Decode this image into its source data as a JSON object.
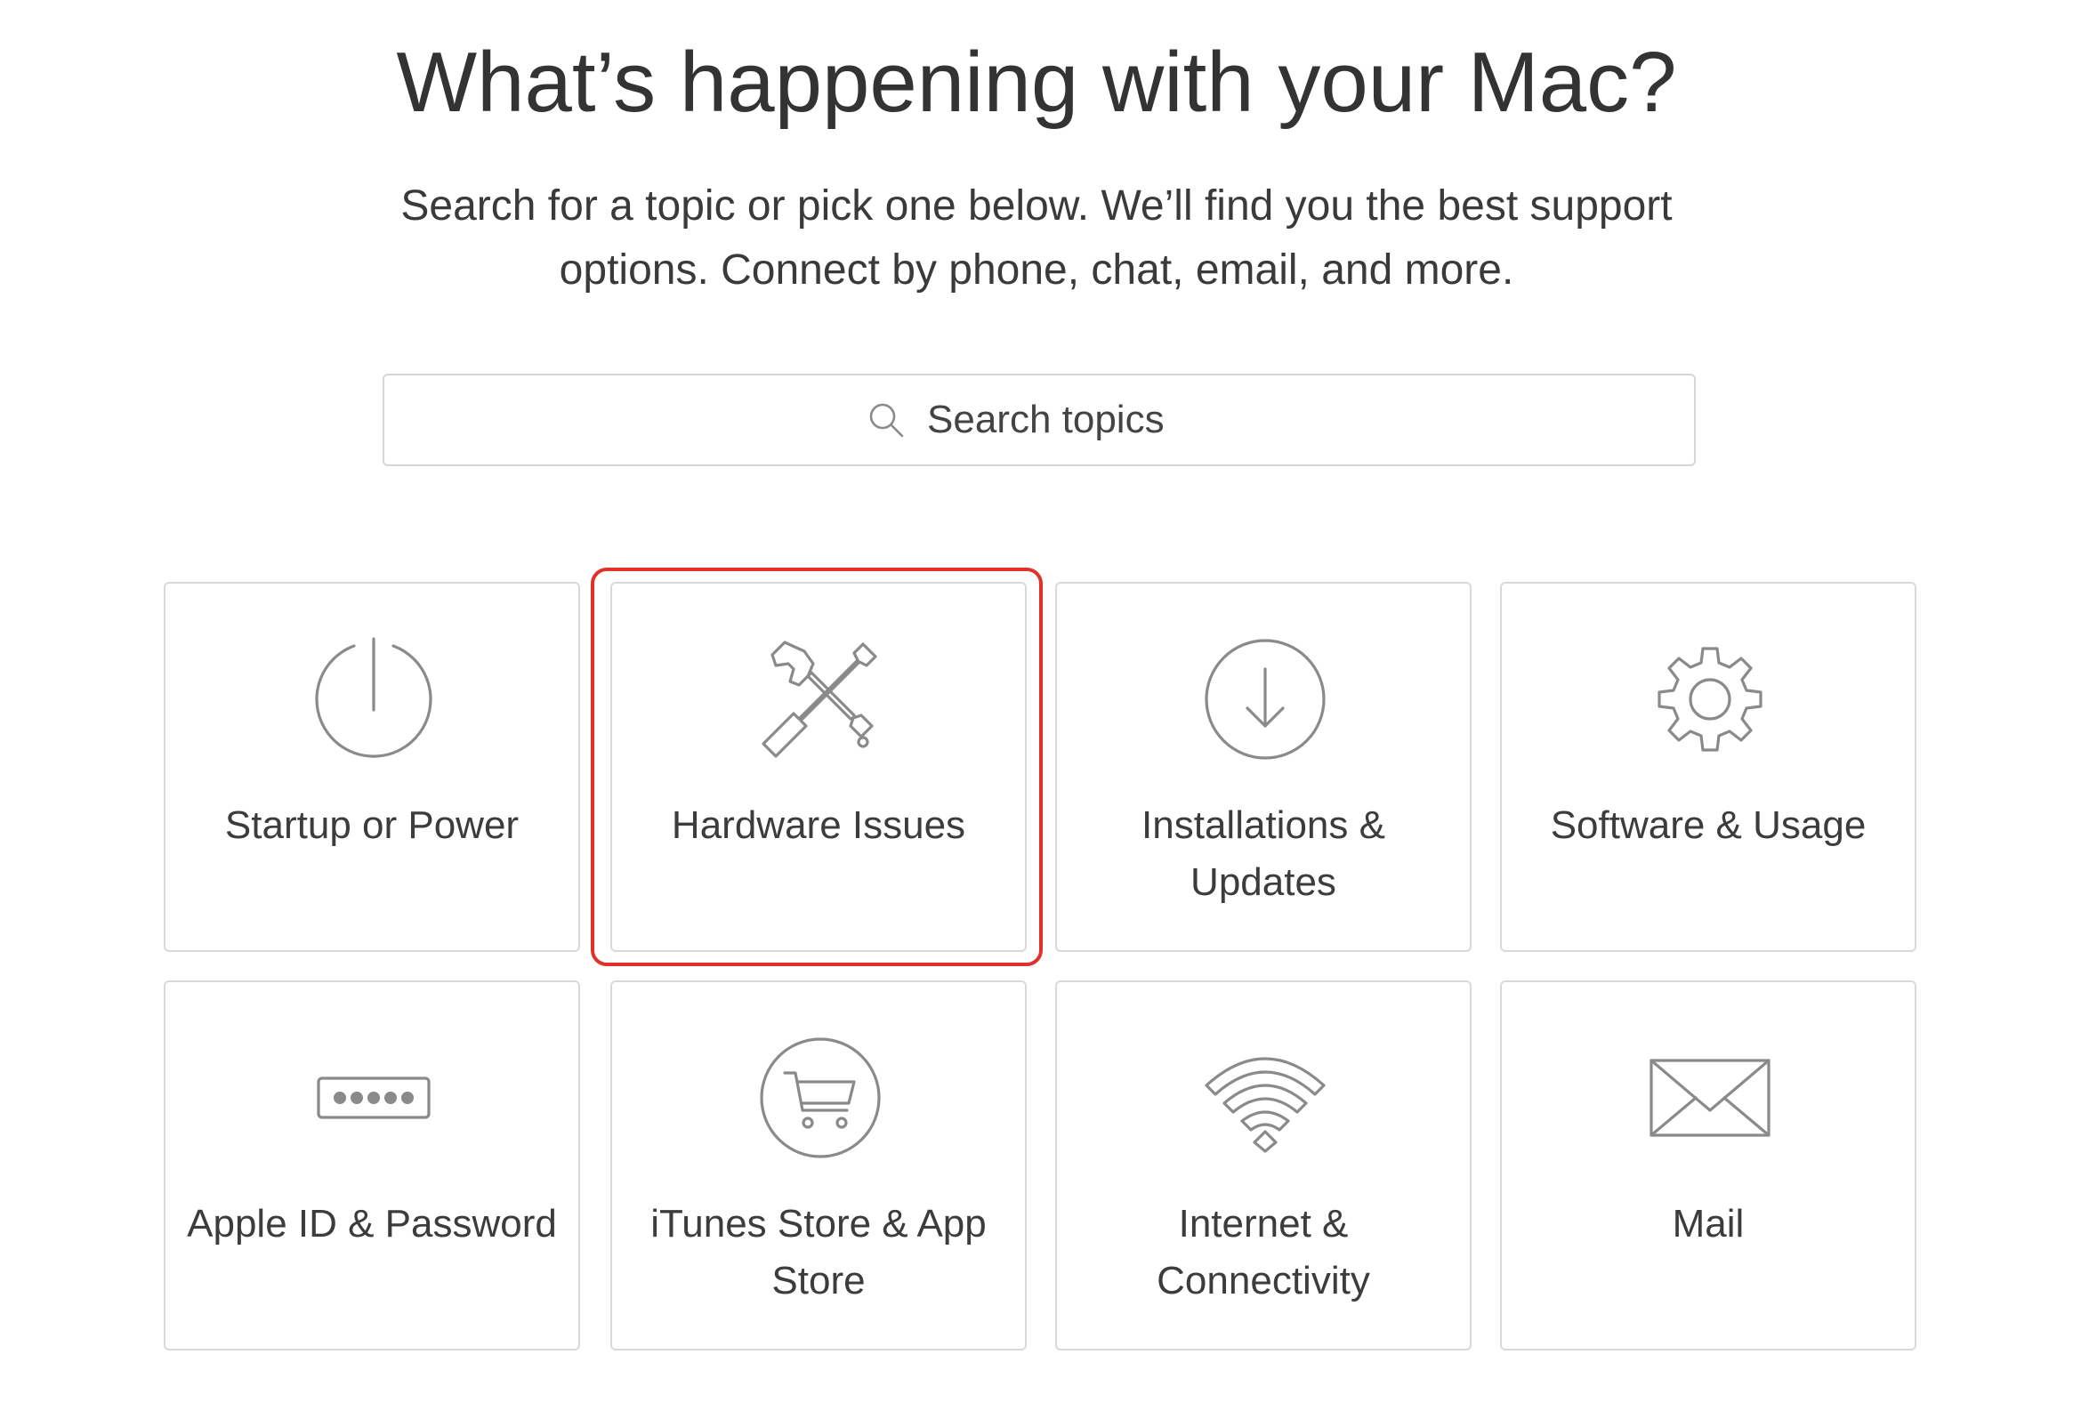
{
  "header": {
    "title": "What’s happening with your Mac?",
    "subtitle_line1": "Search for a topic or pick one below. We’ll find you the best support",
    "subtitle_line2": "options. Connect by phone, chat, email, and more."
  },
  "search": {
    "placeholder": "Search topics",
    "icon": "search-icon"
  },
  "topics": [
    {
      "label": "Startup or Power",
      "icon": "power-icon"
    },
    {
      "label": "Hardware Issues",
      "icon": "tools-icon",
      "highlighted": true
    },
    {
      "label": "Installations & Updates",
      "icon": "download-icon"
    },
    {
      "label": "Software & Usage",
      "icon": "gear-icon"
    },
    {
      "label": "Apple ID & Password",
      "icon": "password-icon"
    },
    {
      "label": "iTunes Store & App Store",
      "icon": "cart-icon"
    },
    {
      "label": "Internet & Connectivity",
      "icon": "wifi-icon"
    },
    {
      "label": "Mail",
      "icon": "envelope-icon"
    }
  ],
  "colors": {
    "highlight": "#e0312b",
    "icon_stroke": "#8a8a8a",
    "tile_border": "#d9d9d9"
  }
}
